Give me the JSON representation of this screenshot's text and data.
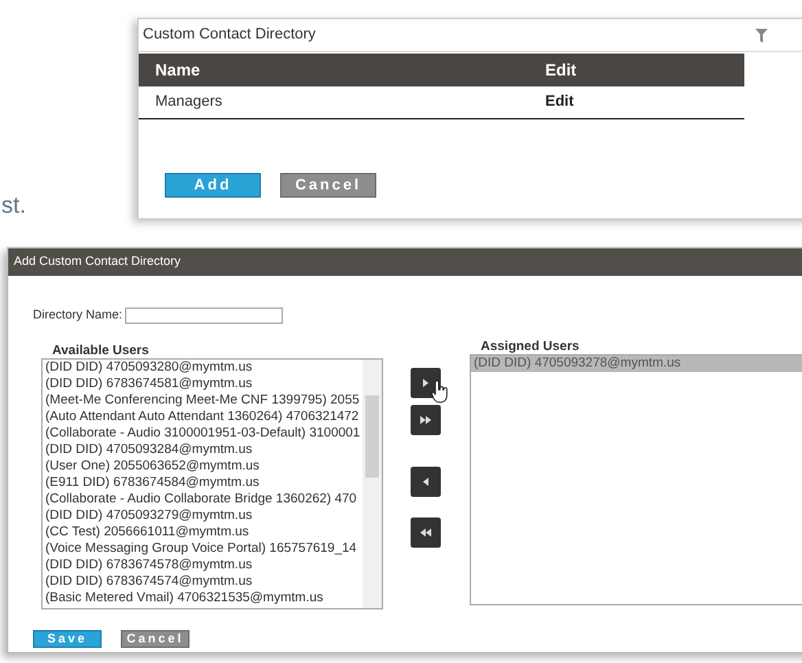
{
  "fragment": "st.",
  "directory_panel": {
    "title": "Custom Contact Directory",
    "columns": [
      "Name",
      "Edit"
    ],
    "rows": [
      {
        "name": "Managers",
        "action": "Edit"
      }
    ],
    "buttons": [
      {
        "label": "Add",
        "kind": "primary"
      },
      {
        "label": "Cancel",
        "kind": "secondary"
      }
    ]
  },
  "dialog": {
    "title": "Add Custom Contact Directory",
    "directory_name": {
      "label": "Directory Name:"
    },
    "available_users": {
      "label": "Available Users",
      "items": [
        {
          "text": "(DID DID) 4705093280@mymtm.us",
          "selected": false
        },
        {
          "text": "(DID DID) 6783674581@mymtm.us",
          "selected": false
        },
        {
          "text": "(Meet-Me Conferencing Meet-Me CNF 1399795) 2055",
          "selected": false
        },
        {
          "text": "(Auto Attendant Auto Attendant 1360264) 4706321472",
          "selected": false
        },
        {
          "text": "(Collaborate - Audio 3100001951-03-Default) 3100001",
          "selected": false
        },
        {
          "text": "(DID DID) 4705093284@mymtm.us",
          "selected": false
        },
        {
          "text": "(User One) 2055063652@mymtm.us",
          "selected": false
        },
        {
          "text": "(E911 DID) 6783674584@mymtm.us",
          "selected": false
        },
        {
          "text": "(Collaborate - Audio Collaborate Bridge 1360262) 470",
          "selected": false
        },
        {
          "text": "(DID DID) 4705093279@mymtm.us",
          "selected": false
        },
        {
          "text": "(CC Test) 2056661011@mymtm.us",
          "selected": false
        },
        {
          "text": "(Voice Messaging Group Voice Portal) 165757619_14",
          "selected": false
        },
        {
          "text": "(DID DID) 6783674578@mymtm.us",
          "selected": false
        },
        {
          "text": "(DID DID) 6783674574@mymtm.us",
          "selected": false
        },
        {
          "text": "(Basic Metered Vmail) 4706321535@mymtm.us",
          "selected": false
        }
      ]
    },
    "move_buttons": [
      {
        "kind": "add"
      },
      {
        "kind": "add_all"
      },
      {
        "kind": "remove"
      },
      {
        "kind": "remove_all"
      }
    ],
    "assigned_users": {
      "label": "Assigned Users",
      "items": [
        {
          "text": "(DID DID) 4705093278@mymtm.us",
          "selected": true
        }
      ]
    },
    "buttons": [
      {
        "label": "Save",
        "kind": "primary"
      },
      {
        "label": "Cancel",
        "kind": "secondary"
      }
    ]
  }
}
